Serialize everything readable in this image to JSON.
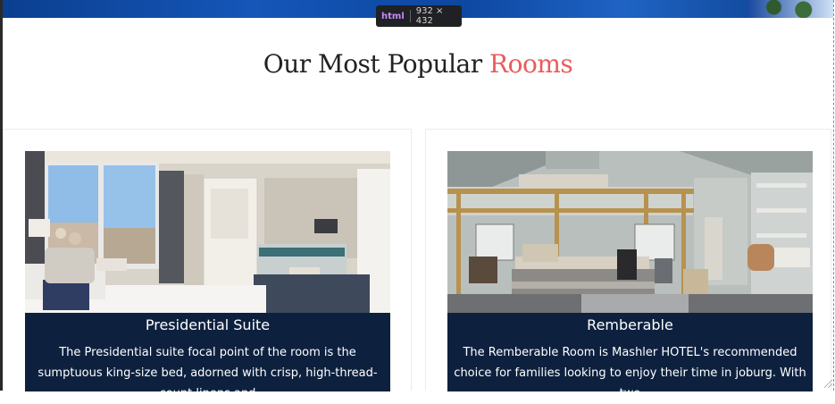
{
  "devtools": {
    "tag": "html",
    "size": "932 × 432"
  },
  "section": {
    "title_main": "Our Most Popular ",
    "title_accent": "Rooms"
  },
  "rooms": [
    {
      "name": "Presidential Suite",
      "description": "The Presidential suite focal point of the room is the sumptuous king-size bed, adorned with crisp, high-thread-count linens and"
    },
    {
      "name": "Remberable",
      "description": "The Remberable Room is Mashler HOTEL's recommended choice for families looking to enjoy their time in joburg. With two"
    }
  ],
  "colors": {
    "accent": "#e85c5c",
    "caption_bg": "#0d213f"
  }
}
